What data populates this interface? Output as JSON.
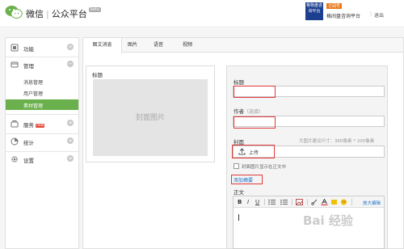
{
  "header": {
    "app_name": "微信",
    "platform": "公众平台",
    "beta_tag": "beta",
    "avatar_text": "格物盘咨询平台",
    "account_tag": "订阅号",
    "account_name": "格间盘咨询平台",
    "separator": "|",
    "logout": "退出"
  },
  "sidebar": {
    "sections": [
      {
        "label": "功能",
        "icon": "function-icon",
        "toggle": "+"
      },
      {
        "label": "管理",
        "icon": "manage-icon",
        "toggle": "−"
      },
      {
        "label": "服务",
        "icon": "service-icon",
        "toggle": "+",
        "badge": "new"
      },
      {
        "label": "统计",
        "icon": "stats-icon",
        "toggle": "+"
      },
      {
        "label": "设置",
        "icon": "settings-gear-icon",
        "toggle": "+"
      }
    ],
    "sub_items": [
      "消息管理",
      "用户管理",
      "素材管理"
    ],
    "active_sub": "素材管理"
  },
  "tabs": [
    "图文消息",
    "图片",
    "语音",
    "视频"
  ],
  "cover": {
    "title": "标题",
    "placeholder": "封面图片"
  },
  "form": {
    "title_label": "标题",
    "author_label": "作者",
    "author_hint": "（选填）",
    "cover_label": "封面",
    "cover_hint": "大图片建议尺寸：360像素 * 200像素",
    "upload_label": "上传",
    "show_cover_label": "封面图片显示在正文中",
    "add_summary": "添加摘要",
    "body_label": "正文"
  },
  "editor": {
    "bold": "B",
    "italic": "I",
    "underline": "U",
    "expand": "放大编辑"
  },
  "watermark": "Bai 经验",
  "colors": {
    "accent_green": "#6ab04c",
    "highlight_red": "#e03a3a",
    "link_blue": "#1a6fc9"
  }
}
